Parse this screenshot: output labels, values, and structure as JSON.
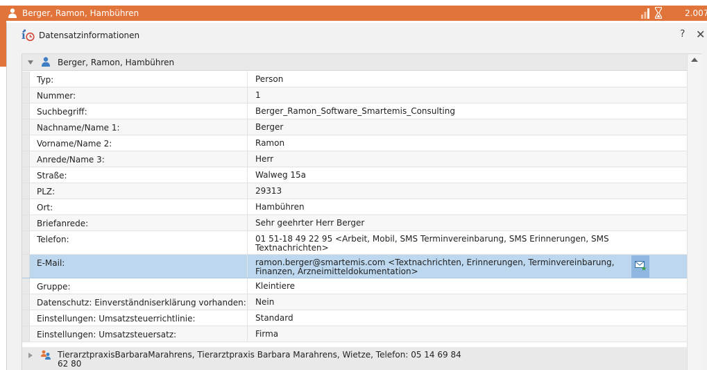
{
  "window": {
    "title": "Berger, Ramon, Hambühren",
    "version": "2.007"
  },
  "dialog": {
    "title": "Datensatzinformationen",
    "help_label": "?",
    "close_label": "✕"
  },
  "record_group": {
    "label": "Berger, Ramon, Hambühren"
  },
  "fields": [
    {
      "key": "Typ:",
      "value": "Person"
    },
    {
      "key": "Nummer:",
      "value": "1"
    },
    {
      "key": "Suchbegriff:",
      "value": "Berger_Ramon_Software_Smartemis_Consulting"
    },
    {
      "key": "Nachname/Name 1:",
      "value": "Berger"
    },
    {
      "key": "Vorname/Name 2:",
      "value": "Ramon"
    },
    {
      "key": "Anrede/Name 3:",
      "value": "Herr"
    },
    {
      "key": "Straße:",
      "value": "Walweg 15a"
    },
    {
      "key": "PLZ:",
      "value": "29313"
    },
    {
      "key": "Ort:",
      "value": "Hambühren"
    },
    {
      "key": "Briefanrede:",
      "value": "Sehr geehrter Herr Berger"
    },
    {
      "key": "Telefon:",
      "value": "01 51-18 49 22 95 <Arbeit, Mobil, SMS Terminvereinbarung, SMS Erinnerungen, SMS Textnachrichten>"
    },
    {
      "key": "E-Mail:",
      "value": "ramon.berger@smartemis.com <Textnachrichten, Erinnerungen, Terminvereinbarung, Finanzen, Arzneimitteldokumentation>"
    },
    {
      "key": "Gruppe:",
      "value": "Kleintiere"
    },
    {
      "key": "Datenschutz: Einverständniserklärung vorhanden:",
      "value": "Nein"
    },
    {
      "key": "Einstellungen: Umsatzsteuerrichtlinie:",
      "value": "Standard"
    },
    {
      "key": "Einstellungen: Umsatzsteuersatz:",
      "value": "Firma"
    }
  ],
  "second_group": {
    "label": "TierarztpraxisBarbaraMarahrens, Tierarztpraxis Barbara Marahrens, Wietze, Telefon: 05 14 69 84 62 80"
  },
  "icons": {
    "window": "person-icon",
    "signal": "signal-bars-icon",
    "hourglass": "hourglass-icon",
    "dialog": "info-clock-icon",
    "mail": "mail-star-icon",
    "group": "people-icon"
  },
  "colors": {
    "accent": "#e0743a",
    "selected_row": "#bcd7ee",
    "person_icon": "#3d7fc1"
  }
}
